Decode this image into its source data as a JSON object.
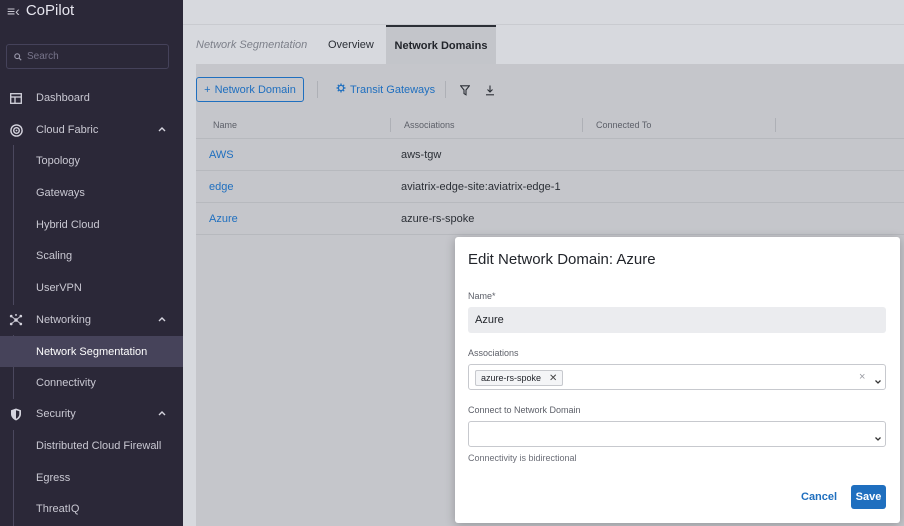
{
  "app": {
    "title": "CoPilot"
  },
  "search": {
    "placeholder": "Search"
  },
  "sidebar": {
    "items": [
      {
        "label": "Dashboard",
        "icon": "dashboard-icon"
      },
      {
        "label": "Cloud Fabric",
        "icon": "cloud-fabric-icon",
        "expanded": true
      },
      {
        "label": "Topology"
      },
      {
        "label": "Gateways"
      },
      {
        "label": "Hybrid Cloud"
      },
      {
        "label": "Scaling"
      },
      {
        "label": "UserVPN"
      },
      {
        "label": "Networking",
        "icon": "networking-icon",
        "expanded": true
      },
      {
        "label": "Network Segmentation",
        "active": true
      },
      {
        "label": "Connectivity"
      },
      {
        "label": "Security",
        "icon": "shield-icon",
        "expanded": true
      },
      {
        "label": "Distributed Cloud Firewall"
      },
      {
        "label": "Egress"
      },
      {
        "label": "ThreatIQ"
      }
    ]
  },
  "tabs": {
    "breadcrumb": "Network Segmentation",
    "overview": "Overview",
    "network_domains": "Network Domains"
  },
  "toolbar": {
    "add_label": "Network Domain",
    "transit_label": "Transit Gateways"
  },
  "table": {
    "columns": [
      "Name",
      "Associations",
      "Connected To"
    ],
    "rows": [
      {
        "name": "AWS",
        "associations": "aws-tgw",
        "connected_to": ""
      },
      {
        "name": "edge",
        "associations": "aviatrix-edge-site:aviatrix-edge-1",
        "connected_to": ""
      },
      {
        "name": "Azure",
        "associations": "azure-rs-spoke",
        "connected_to": ""
      }
    ]
  },
  "dialog": {
    "title": "Edit Network Domain: Azure",
    "name_label": "Name*",
    "name_value": "Azure",
    "associations_label": "Associations",
    "association_chip": "azure-rs-spoke",
    "connect_label": "Connect to Network Domain",
    "connect_value": "",
    "hint": "Connectivity is bidirectional",
    "cancel_label": "Cancel",
    "save_label": "Save"
  },
  "colors": {
    "sidebar_bg": "#2b2838",
    "sidebar_active": "#46435a",
    "accent": "#1f6fbf",
    "main_bg": "#c5c6cb"
  }
}
